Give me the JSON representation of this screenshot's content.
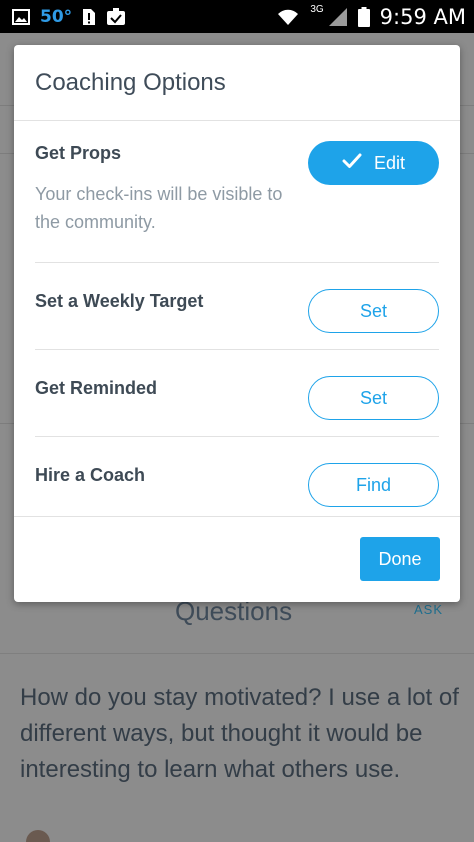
{
  "status_bar": {
    "temperature": "50°",
    "network": "3G",
    "time": "9:59 AM"
  },
  "dialog": {
    "title": "Coaching Options",
    "options": [
      {
        "label": "Get Props",
        "description": "Your check-ins will be visible to the community.",
        "button_label": "Edit",
        "button_icon": "checkmark-icon"
      },
      {
        "label": "Set a Weekly Target",
        "button_label": "Set"
      },
      {
        "label": "Get Reminded",
        "button_label": "Set"
      },
      {
        "label": "Hire a Coach",
        "button_label": "Find"
      }
    ],
    "done_label": "Done"
  },
  "background": {
    "section_title": "Questions",
    "ask_link": "ASK",
    "question_text": "How do you stay motivated? I use a lot of different ways, but thought it would be interesting to learn what others use."
  },
  "colors": {
    "accent": "#1ea3e9",
    "title_text": "#3f4c59",
    "muted_text": "#8e9aa4",
    "overlay": "#8c8c8c"
  }
}
